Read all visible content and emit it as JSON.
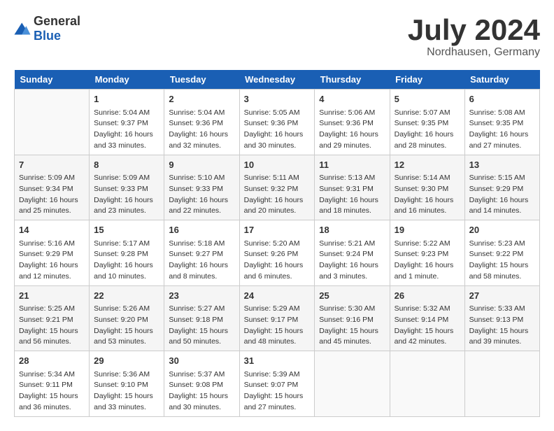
{
  "header": {
    "logo_general": "General",
    "logo_blue": "Blue",
    "month_title": "July 2024",
    "subtitle": "Nordhausen, Germany"
  },
  "days_of_week": [
    "Sunday",
    "Monday",
    "Tuesday",
    "Wednesday",
    "Thursday",
    "Friday",
    "Saturday"
  ],
  "weeks": [
    [
      {
        "day": "",
        "info": ""
      },
      {
        "day": "1",
        "info": "Sunrise: 5:04 AM\nSunset: 9:37 PM\nDaylight: 16 hours\nand 33 minutes."
      },
      {
        "day": "2",
        "info": "Sunrise: 5:04 AM\nSunset: 9:36 PM\nDaylight: 16 hours\nand 32 minutes."
      },
      {
        "day": "3",
        "info": "Sunrise: 5:05 AM\nSunset: 9:36 PM\nDaylight: 16 hours\nand 30 minutes."
      },
      {
        "day": "4",
        "info": "Sunrise: 5:06 AM\nSunset: 9:36 PM\nDaylight: 16 hours\nand 29 minutes."
      },
      {
        "day": "5",
        "info": "Sunrise: 5:07 AM\nSunset: 9:35 PM\nDaylight: 16 hours\nand 28 minutes."
      },
      {
        "day": "6",
        "info": "Sunrise: 5:08 AM\nSunset: 9:35 PM\nDaylight: 16 hours\nand 27 minutes."
      }
    ],
    [
      {
        "day": "7",
        "info": "Sunrise: 5:09 AM\nSunset: 9:34 PM\nDaylight: 16 hours\nand 25 minutes."
      },
      {
        "day": "8",
        "info": "Sunrise: 5:09 AM\nSunset: 9:33 PM\nDaylight: 16 hours\nand 23 minutes."
      },
      {
        "day": "9",
        "info": "Sunrise: 5:10 AM\nSunset: 9:33 PM\nDaylight: 16 hours\nand 22 minutes."
      },
      {
        "day": "10",
        "info": "Sunrise: 5:11 AM\nSunset: 9:32 PM\nDaylight: 16 hours\nand 20 minutes."
      },
      {
        "day": "11",
        "info": "Sunrise: 5:13 AM\nSunset: 9:31 PM\nDaylight: 16 hours\nand 18 minutes."
      },
      {
        "day": "12",
        "info": "Sunrise: 5:14 AM\nSunset: 9:30 PM\nDaylight: 16 hours\nand 16 minutes."
      },
      {
        "day": "13",
        "info": "Sunrise: 5:15 AM\nSunset: 9:29 PM\nDaylight: 16 hours\nand 14 minutes."
      }
    ],
    [
      {
        "day": "14",
        "info": "Sunrise: 5:16 AM\nSunset: 9:29 PM\nDaylight: 16 hours\nand 12 minutes."
      },
      {
        "day": "15",
        "info": "Sunrise: 5:17 AM\nSunset: 9:28 PM\nDaylight: 16 hours\nand 10 minutes."
      },
      {
        "day": "16",
        "info": "Sunrise: 5:18 AM\nSunset: 9:27 PM\nDaylight: 16 hours\nand 8 minutes."
      },
      {
        "day": "17",
        "info": "Sunrise: 5:20 AM\nSunset: 9:26 PM\nDaylight: 16 hours\nand 6 minutes."
      },
      {
        "day": "18",
        "info": "Sunrise: 5:21 AM\nSunset: 9:24 PM\nDaylight: 16 hours\nand 3 minutes."
      },
      {
        "day": "19",
        "info": "Sunrise: 5:22 AM\nSunset: 9:23 PM\nDaylight: 16 hours\nand 1 minute."
      },
      {
        "day": "20",
        "info": "Sunrise: 5:23 AM\nSunset: 9:22 PM\nDaylight: 15 hours\nand 58 minutes."
      }
    ],
    [
      {
        "day": "21",
        "info": "Sunrise: 5:25 AM\nSunset: 9:21 PM\nDaylight: 15 hours\nand 56 minutes."
      },
      {
        "day": "22",
        "info": "Sunrise: 5:26 AM\nSunset: 9:20 PM\nDaylight: 15 hours\nand 53 minutes."
      },
      {
        "day": "23",
        "info": "Sunrise: 5:27 AM\nSunset: 9:18 PM\nDaylight: 15 hours\nand 50 minutes."
      },
      {
        "day": "24",
        "info": "Sunrise: 5:29 AM\nSunset: 9:17 PM\nDaylight: 15 hours\nand 48 minutes."
      },
      {
        "day": "25",
        "info": "Sunrise: 5:30 AM\nSunset: 9:16 PM\nDaylight: 15 hours\nand 45 minutes."
      },
      {
        "day": "26",
        "info": "Sunrise: 5:32 AM\nSunset: 9:14 PM\nDaylight: 15 hours\nand 42 minutes."
      },
      {
        "day": "27",
        "info": "Sunrise: 5:33 AM\nSunset: 9:13 PM\nDaylight: 15 hours\nand 39 minutes."
      }
    ],
    [
      {
        "day": "28",
        "info": "Sunrise: 5:34 AM\nSunset: 9:11 PM\nDaylight: 15 hours\nand 36 minutes."
      },
      {
        "day": "29",
        "info": "Sunrise: 5:36 AM\nSunset: 9:10 PM\nDaylight: 15 hours\nand 33 minutes."
      },
      {
        "day": "30",
        "info": "Sunrise: 5:37 AM\nSunset: 9:08 PM\nDaylight: 15 hours\nand 30 minutes."
      },
      {
        "day": "31",
        "info": "Sunrise: 5:39 AM\nSunset: 9:07 PM\nDaylight: 15 hours\nand 27 minutes."
      },
      {
        "day": "",
        "info": ""
      },
      {
        "day": "",
        "info": ""
      },
      {
        "day": "",
        "info": ""
      }
    ]
  ]
}
